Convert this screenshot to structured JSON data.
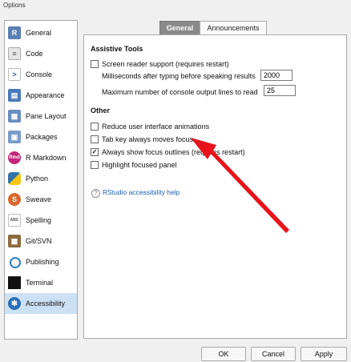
{
  "window": {
    "title": "Options"
  },
  "sidebar": {
    "items": [
      {
        "label": "General",
        "icon": "r-logo-icon",
        "color": "#5a7fb3"
      },
      {
        "label": "Code",
        "icon": "code-icon",
        "color": "#8e8e8e"
      },
      {
        "label": "Console",
        "icon": "console-icon",
        "color": "#ffffff"
      },
      {
        "label": "Appearance",
        "icon": "appearance-icon",
        "color": "#4a79b8"
      },
      {
        "label": "Pane Layout",
        "icon": "pane-layout-icon",
        "color": "#6a8fbf"
      },
      {
        "label": "Packages",
        "icon": "packages-icon",
        "color": "#7a9bc8"
      },
      {
        "label": "R Markdown",
        "icon": "rmarkdown-icon",
        "color": "#c3267b"
      },
      {
        "label": "Python",
        "icon": "python-icon",
        "color": "#3572a5"
      },
      {
        "label": "Sweave",
        "icon": "sweave-icon",
        "color": "#d9662b"
      },
      {
        "label": "Spelling",
        "icon": "spelling-icon",
        "color": "#9a9a9a"
      },
      {
        "label": "Git/SVN",
        "icon": "git-icon",
        "color": "#8b6a3e"
      },
      {
        "label": "Publishing",
        "icon": "publishing-icon",
        "color": "#2f7fc1"
      },
      {
        "label": "Terminal",
        "icon": "terminal-icon",
        "color": "#111111"
      },
      {
        "label": "Accessibility",
        "icon": "accessibility-icon",
        "color": "#2a6db8",
        "selected": true
      }
    ]
  },
  "tabs": [
    {
      "label": "General",
      "active": true
    },
    {
      "label": "Announcements",
      "active": false
    }
  ],
  "assistive": {
    "heading": "Assistive Tools",
    "screen_reader": {
      "label": "Screen reader support (requires restart)",
      "checked": false
    },
    "ms_label": "Milliseconds after typing before speaking results",
    "ms_value": "2000",
    "max_lines_label": "Maximum number of console output lines to read",
    "max_lines_value": "25"
  },
  "other": {
    "heading": "Other",
    "options": [
      {
        "label": "Reduce user interface animations",
        "checked": false
      },
      {
        "label": "Tab key always moves focus",
        "checked": false
      },
      {
        "label": "Always show focus outlines (requires restart)",
        "checked": true
      },
      {
        "label": "Highlight focused panel",
        "checked": false
      }
    ]
  },
  "help_link": "RStudio accessibility help",
  "buttons": {
    "ok": "OK",
    "cancel": "Cancel",
    "apply": "Apply"
  },
  "annotation": {
    "arrow_color": "#e8121b"
  }
}
